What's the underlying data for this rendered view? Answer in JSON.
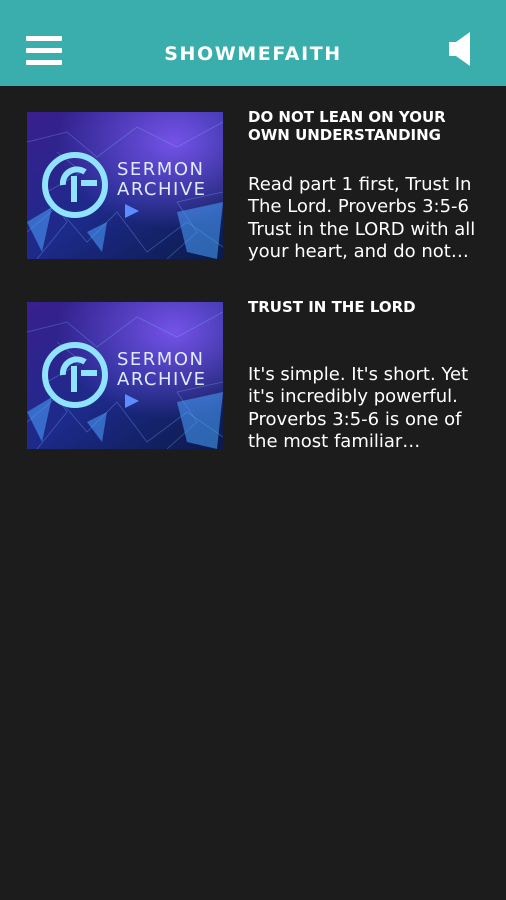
{
  "header": {
    "title": "SHOWMEFAITH",
    "menu_icon": "hamburger-menu-icon",
    "sound_icon": "speaker-icon",
    "background_color": "#3aaeac"
  },
  "thumbnail": {
    "line1": "SERMON",
    "line2": "ARCHIVE"
  },
  "posts": [
    {
      "title": "DO NOT LEAN ON YOUR OWN UNDERSTANDING",
      "excerpt": "Read part 1 first, Trust In The Lord. Proverbs 3:5-6 Trust in the LORD with all your heart, and do not…"
    },
    {
      "title": "TRUST IN THE LORD",
      "excerpt": "It's simple. It's short. Yet it's incredibly powerful. Proverbs 3:5-6 is one of the most familiar…"
    }
  ],
  "colors": {
    "background": "#1c1c1c",
    "text": "#ffffff",
    "accent": "#3aaeac"
  }
}
